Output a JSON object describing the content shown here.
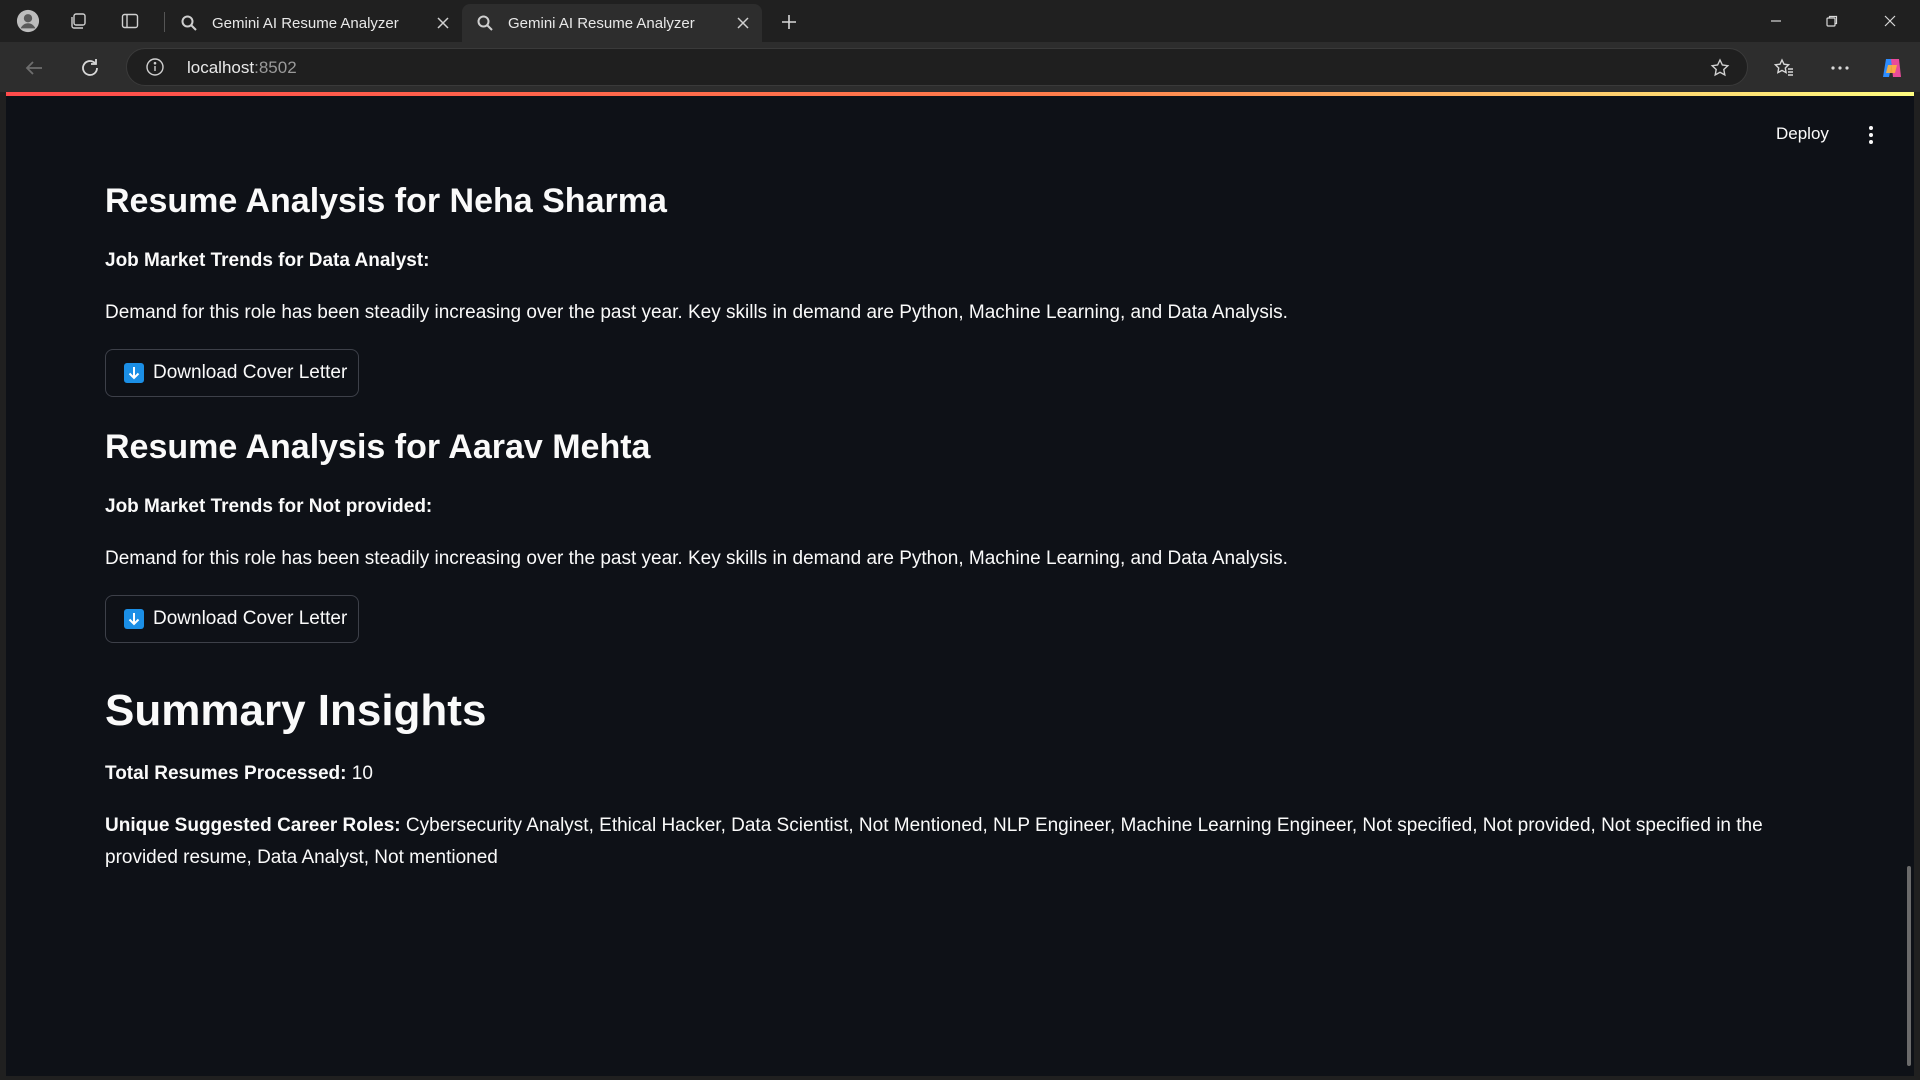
{
  "browser": {
    "tabs": [
      {
        "title": "Gemini AI Resume Analyzer",
        "active": false
      },
      {
        "title": "Gemini AI Resume Analyzer",
        "active": true
      }
    ],
    "url_host": "localhost",
    "url_port": ":8502"
  },
  "toolbar": {
    "deploy_label": "Deploy"
  },
  "analyses": [
    {
      "heading": "Resume Analysis for Neha Sharma",
      "trends_heading": "Job Market Trends for Data Analyst:",
      "trends_text": "Demand for this role has been steadily increasing over the past year. Key skills in demand are Python, Machine Learning, and Data Analysis.",
      "button_label": "Download Cover Letter"
    },
    {
      "heading": "Resume Analysis for Aarav Mehta",
      "trends_heading": "Job Market Trends for Not provided:",
      "trends_text": "Demand for this role has been steadily increasing over the past year. Key skills in demand are Python, Machine Learning, and Data Analysis.",
      "button_label": "Download Cover Letter"
    }
  ],
  "summary": {
    "title": "Summary Insights",
    "total_label": "Total Resumes Processed:",
    "total_value": "10",
    "roles_label": "Unique Suggested Career Roles:",
    "roles_value": "Cybersecurity Analyst, Ethical Hacker, Data Scientist, Not Mentioned, NLP Engineer, Machine Learning Engineer, Not specified, Not provided, Not specified in the provided resume, Data Analyst, Not mentioned"
  },
  "colors": {
    "background": "#0e1117",
    "text": "#fafafa",
    "download_icon": "#1b8fe6",
    "accent_start": "#ff4b4b",
    "accent_end": "#fffd80"
  }
}
